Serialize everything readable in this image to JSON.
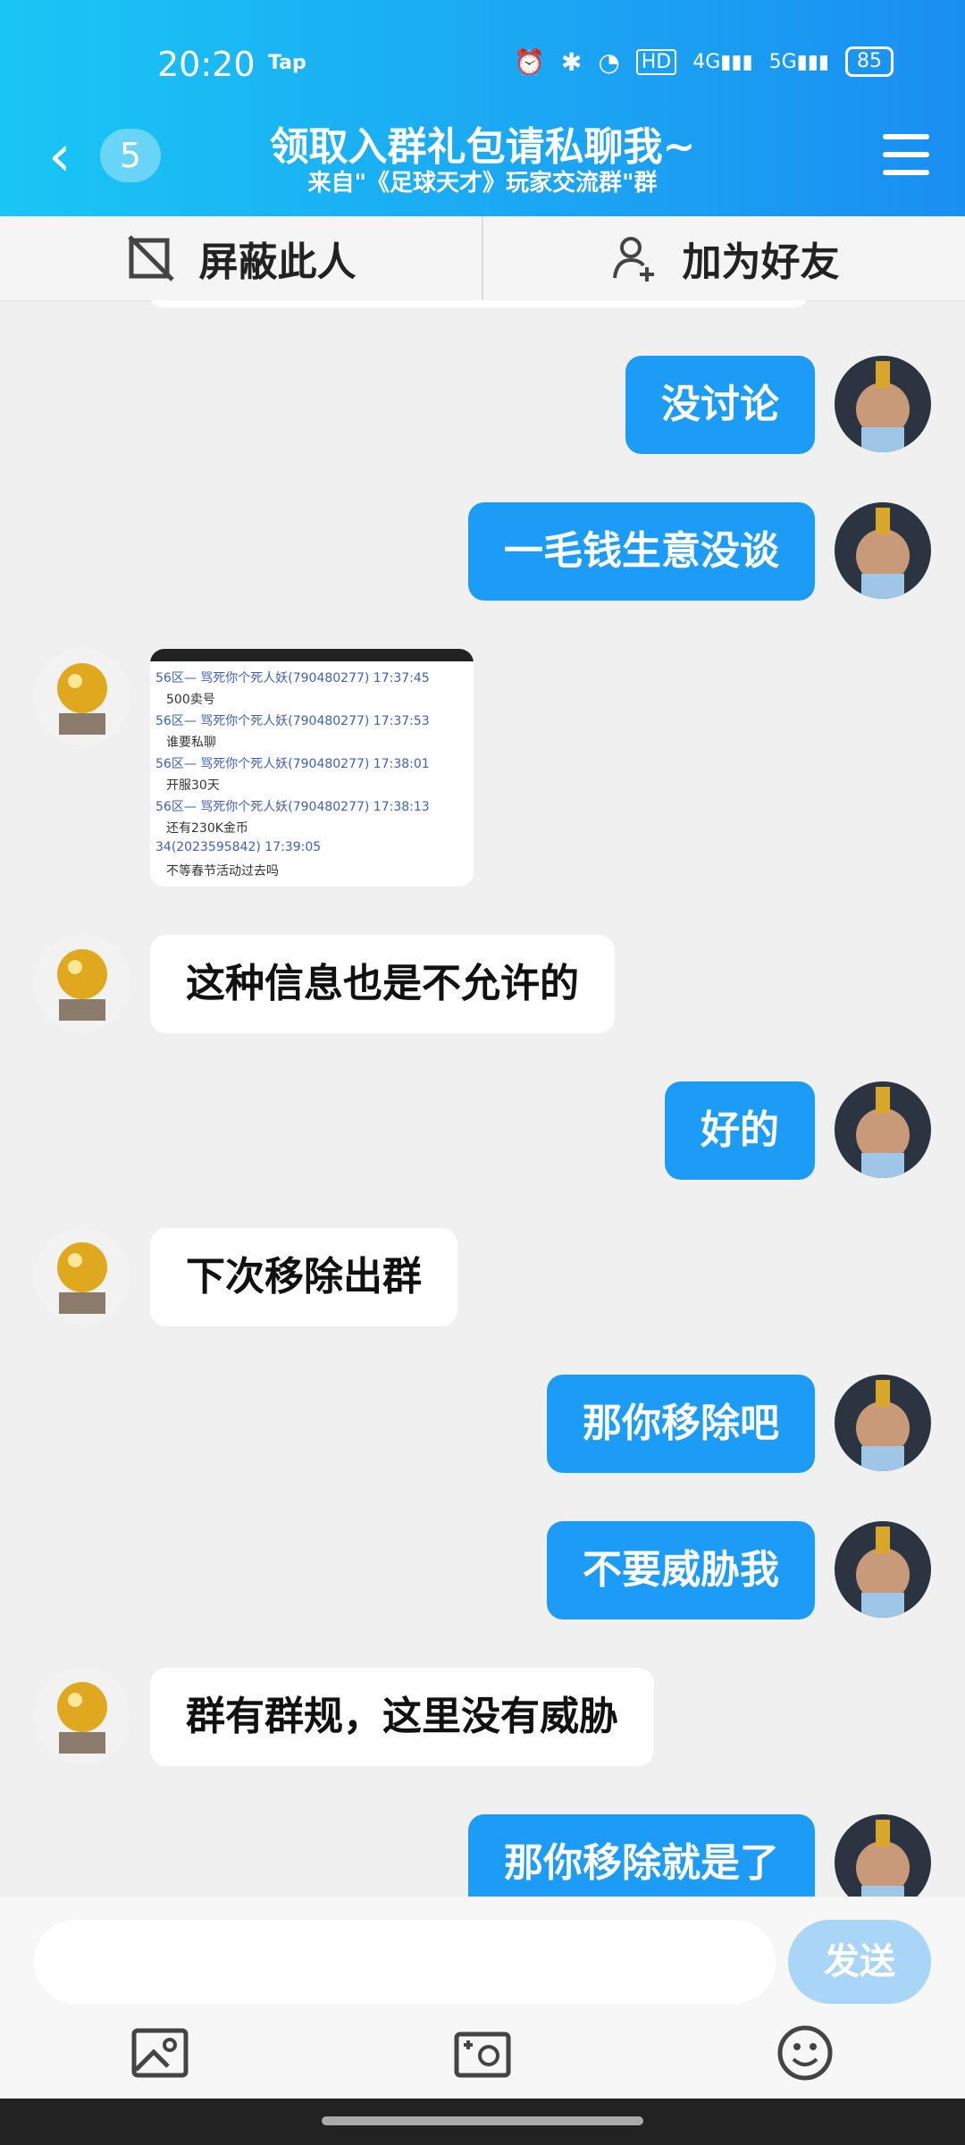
{
  "status": {
    "time": "20:20",
    "tap": "Tap",
    "battery": "85"
  },
  "header": {
    "back_count": "5",
    "title": "领取入群礼包请私聊我~",
    "subtitle": "来自\"《足球天才》玩家交流群\"群"
  },
  "actions": {
    "block": "屏蔽此人",
    "add_friend": "加为好友"
  },
  "messages": [
    {
      "side": "right",
      "text": "没讨论"
    },
    {
      "side": "right",
      "text": "一毛钱生意没谈"
    },
    {
      "side": "left",
      "type": "image"
    },
    {
      "side": "left",
      "text": "这种信息也是不允许的"
    },
    {
      "side": "right",
      "text": "好的"
    },
    {
      "side": "left",
      "text": "下次移除出群"
    },
    {
      "side": "right",
      "text": "那你移除吧"
    },
    {
      "side": "right",
      "text": "不要威胁我"
    },
    {
      "side": "left",
      "text": "群有群规，这里没有威胁"
    },
    {
      "side": "right",
      "text": "那你移除就是了"
    }
  ],
  "image_message": {
    "lines": [
      "56区— 骂死你个死人妖(790480277)  17:37:45",
      "500卖号",
      "56区— 骂死你个死人妖(790480277)  17:37:53",
      "谁要私聊",
      "56区— 骂死你个死人妖(790480277)  17:38:01",
      "开服30天",
      "56区— 骂死你个死人妖(790480277)  17:38:13",
      "还有230K金币",
      "34(2023595842)  17:39:05",
      "不等春节活动过去吗"
    ]
  },
  "input": {
    "placeholder": "",
    "send_label": "发送"
  },
  "colors": {
    "header_start": "#19c6f5",
    "header_end": "#1a8ff2",
    "my_bubble": "#1c9cf6",
    "send_disabled": "#a9d6f6"
  }
}
